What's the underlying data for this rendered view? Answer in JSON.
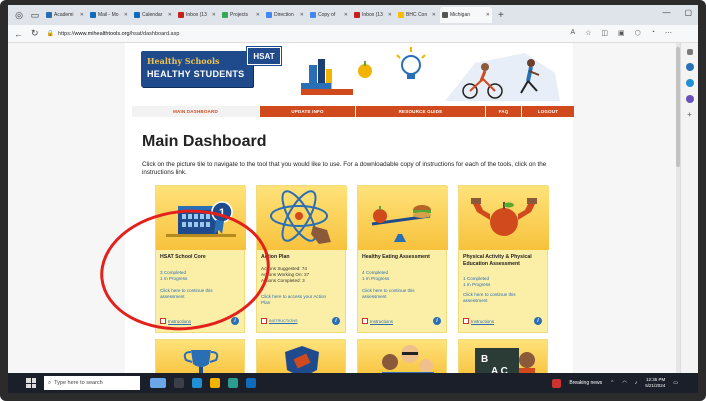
{
  "browser": {
    "tabs": [
      {
        "label": "Academi",
        "color": "#2b6cb0"
      },
      {
        "label": "Mail - Mo",
        "color": "#0f6cbd"
      },
      {
        "label": "Calendar",
        "color": "#0f6cbd"
      },
      {
        "label": "Inbox (13",
        "color": "#c5221f"
      },
      {
        "label": "Projects",
        "color": "#34a853"
      },
      {
        "label": "Direction",
        "color": "#4285f4"
      },
      {
        "label": "Copy of",
        "color": "#4285f4"
      },
      {
        "label": "Inbox (13",
        "color": "#c5221f"
      },
      {
        "label": "BHC Con",
        "color": "#fbbc04"
      },
      {
        "label": "Michigan",
        "color": "#555555"
      }
    ],
    "url_prefix": "https://",
    "url_host": "www.mihealthtools.org",
    "url_path": "/hsat/dashboard.asp"
  },
  "site": {
    "logo_line1": "Healthy Schools",
    "logo_line2": "HEALTHY STUDENTS",
    "badge": "HSAT"
  },
  "nav": [
    "MAIN DASHBOARD",
    "UPDATE INFO",
    "RESOURCE GUIDE",
    "FAQ",
    "LOGOUT"
  ],
  "page": {
    "title": "Main Dashboard",
    "description": "Click on the picture tile to navigate to the tool that you would like to use. For a downloadable copy of instructions for each of the tools, click on the instructions link."
  },
  "tiles": [
    {
      "title": "HSAT School Core",
      "s1": "3 Completed",
      "s2": "1 In Progress",
      "link": "Click here to continue this assessment",
      "instr": "Instructions"
    },
    {
      "title": "Action Plan",
      "s1": "Actions Suggested: 74",
      "s2": "Actions Working On: 37",
      "s3": "Actions Completed: 3",
      "link": "Click here to access your Action Plan",
      "instr": "INSTRUCTIONS"
    },
    {
      "title": "Healthy Eating Assessment",
      "s1": "4 Completed",
      "s2": "1 In Progress",
      "link": "Click here to continue this assessment",
      "instr": "Instructions"
    },
    {
      "title": "Physical Activity & Physical Education Assessment",
      "s1": "1 Completed",
      "s2": "1 In Progress",
      "link": "Click here to continue this assessment",
      "instr": "Instructions"
    }
  ],
  "taskbar": {
    "search_placeholder": "Type here to search",
    "news": "Breaking news",
    "time": "12:35 PM",
    "date": "5/21/2024"
  }
}
